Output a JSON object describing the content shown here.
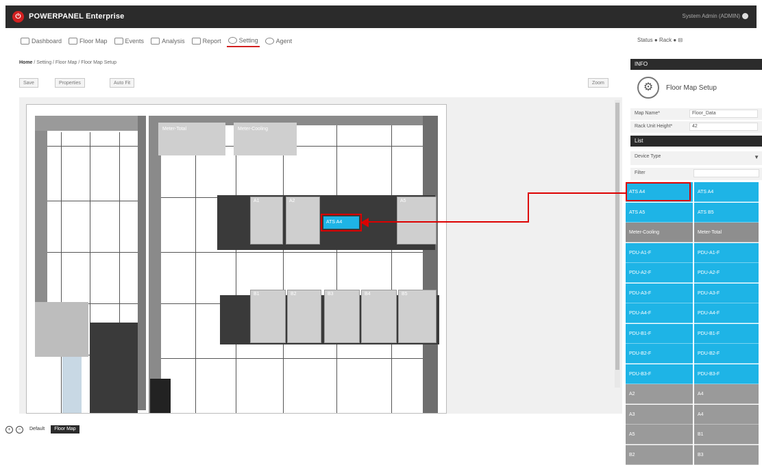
{
  "app": {
    "title": "POWERPANEL Enterprise",
    "user": "System Admin (ADMIN)"
  },
  "nav": {
    "items": [
      {
        "label": "Dashboard"
      },
      {
        "label": "Floor Map"
      },
      {
        "label": "Events"
      },
      {
        "label": "Analysis"
      },
      {
        "label": "Report"
      },
      {
        "label": "Setting",
        "active": true
      },
      {
        "label": "Agent"
      }
    ],
    "right": "Status ● Rack ● ⊟"
  },
  "breadcrumb": "Setting / Floor Map / Floor Map Setup",
  "breadcrumb_home": "Home",
  "toolbar": {
    "save": "Save",
    "properties": "Properties",
    "autofit": "Auto Fit",
    "zoom": "Zoom"
  },
  "map": {
    "top_tiles": [
      "Meter-Total",
      "Meter-Cooling"
    ],
    "row1_tiles": [
      "A1",
      "A2",
      "",
      "",
      "A5"
    ],
    "row2_tiles": [
      "B1",
      "B2",
      "B3",
      "B4",
      "B5"
    ],
    "highlight_label": "ATS A4"
  },
  "bottom": {
    "tab_default": "Default",
    "tab_active": "Floor Map"
  },
  "info": {
    "header": "INFO",
    "setup_title": "Floor Map Setup",
    "fields": [
      {
        "label": "Map Name*",
        "value": "Floor_Data"
      },
      {
        "label": "Rack Unit Height*",
        "value": "42"
      }
    ],
    "list_header": "List",
    "device_type_label": "Device Type",
    "device_type_value": "",
    "filter_label": "Filter",
    "devices": [
      [
        "ATS A4",
        "ATS A4"
      ],
      [
        "ATS A5",
        "ATS B5"
      ],
      [
        "Meter-Cooling",
        "Meter-Total"
      ],
      [
        "PDU-A1-F",
        "PDU-A1-F"
      ],
      [
        "PDU-A2-F",
        "PDU-A2-F"
      ],
      [
        "PDU-A3-F",
        "PDU-A3-F"
      ],
      [
        "PDU-A4-F",
        "PDU-A4-F"
      ],
      [
        "PDU-B1-F",
        "PDU-B1-F"
      ],
      [
        "PDU-B2-F",
        "PDU-B2-F"
      ],
      [
        "PDU-B3-F",
        "PDU-B3-F"
      ],
      [
        "A2",
        "A4"
      ],
      [
        "A3",
        "A4"
      ],
      [
        "A5",
        "B1"
      ],
      [
        "B2",
        "B3"
      ]
    ],
    "device_colors": [
      "cyan",
      "cyan",
      "gray",
      "cyan",
      "cyan",
      "cyan",
      "cyan",
      "cyan",
      "cyan",
      "cyan",
      "lgray",
      "lgray",
      "lgray",
      "lgray"
    ]
  },
  "colors": {
    "accent": "#d22020",
    "selection": "#1eb4e6",
    "header": "#2b2b2b"
  }
}
